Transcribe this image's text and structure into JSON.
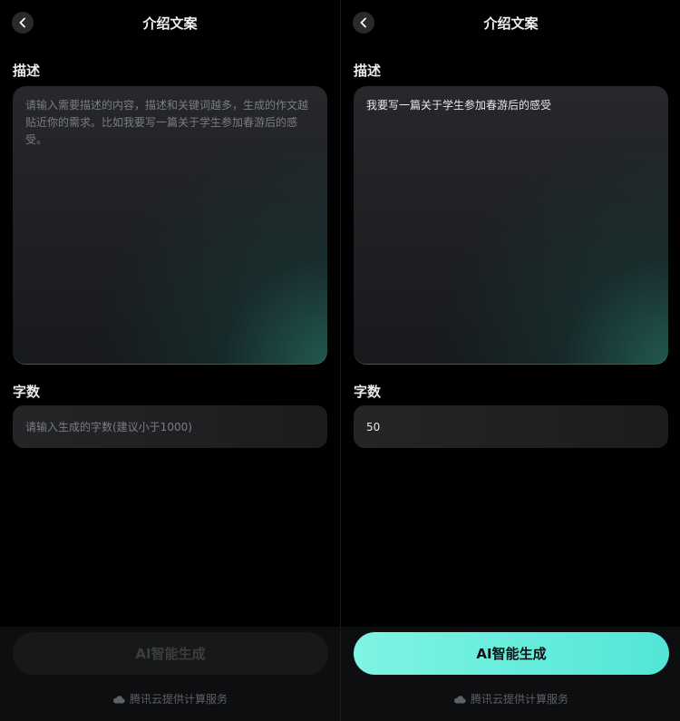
{
  "header": {
    "title": "介绍文案"
  },
  "fields": {
    "description_label": "描述",
    "word_count_label": "字数"
  },
  "left": {
    "description_placeholder": "请输入需要描述的内容，描述和关键词越多，生成的作文越贴近你的需求。比如我要写一篇关于学生参加春游后的感受。",
    "word_count_placeholder": "请输入生成的字数(建议小于1000)",
    "generate_button": "AI智能生成",
    "generate_state": "disabled"
  },
  "right": {
    "description_value": "我要写一篇关于学生参加春游后的感受",
    "word_count_value": "50",
    "generate_button": "AI智能生成",
    "generate_state": "enabled"
  },
  "footer": {
    "text": "腾讯云提供计算服务",
    "icon": "cloud-icon"
  },
  "colors": {
    "accent": "#6ef0e0",
    "background": "#000000"
  }
}
